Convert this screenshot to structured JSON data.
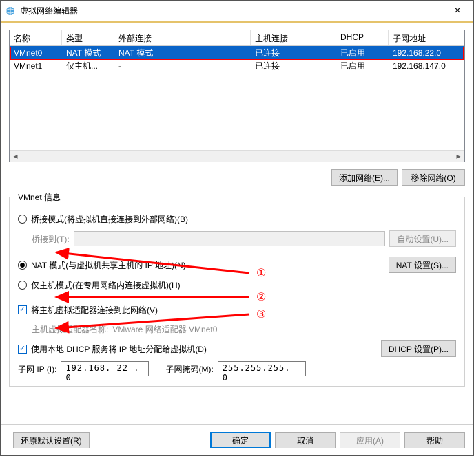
{
  "window": {
    "title": "虚拟网络编辑器",
    "close": "×"
  },
  "columns": {
    "name": "名称",
    "type": "类型",
    "ext": "外部连接",
    "host": "主机连接",
    "dhcp": "DHCP",
    "subnet": "子网地址"
  },
  "rows": [
    {
      "name": "VMnet0",
      "type": "NAT 模式",
      "ext": "NAT 模式",
      "host": "已连接",
      "dhcp": "已启用",
      "subnet": "192.168.22.0"
    },
    {
      "name": "VMnet1",
      "type": "仅主机...",
      "ext": "-",
      "host": "已连接",
      "dhcp": "已启用",
      "subnet": "192.168.147.0"
    }
  ],
  "buttons": {
    "add": "添加网络(E)...",
    "remove": "移除网络(O)",
    "auto": "自动设置(U)...",
    "nat": "NAT 设置(S)...",
    "dhcp": "DHCP 设置(P)...",
    "restore": "还原默认设置(R)",
    "ok": "确定",
    "cancel": "取消",
    "apply": "应用(A)",
    "help": "帮助"
  },
  "group": {
    "title": "VMnet 信息"
  },
  "opts": {
    "bridge": "桥接模式(将虚拟机直接连接到外部网络)(B)",
    "bridgeto": "桥接到(T):",
    "nat": "NAT 模式(与虚拟机共享主机的 IP 地址)(N)",
    "hostonly": "仅主机模式(在专用网络内连接虚拟机)(H)",
    "connect": "将主机虚拟适配器连接到此网络(V)",
    "hostadapter_label": "主机虚拟适配器名称: ",
    "hostadapter_value": "VMware 网络适配器 VMnet0",
    "usedhcp": "使用本地 DHCP 服务将 IP 地址分配给虚拟机(D)",
    "subnet_ip_label": "子网 IP (I):",
    "subnet_ip": "192.168. 22 . 0",
    "subnet_mask_label": "子网掩码(M):",
    "subnet_mask": "255.255.255. 0"
  },
  "annot": {
    "n1": "①",
    "n2": "②",
    "n3": "③"
  }
}
